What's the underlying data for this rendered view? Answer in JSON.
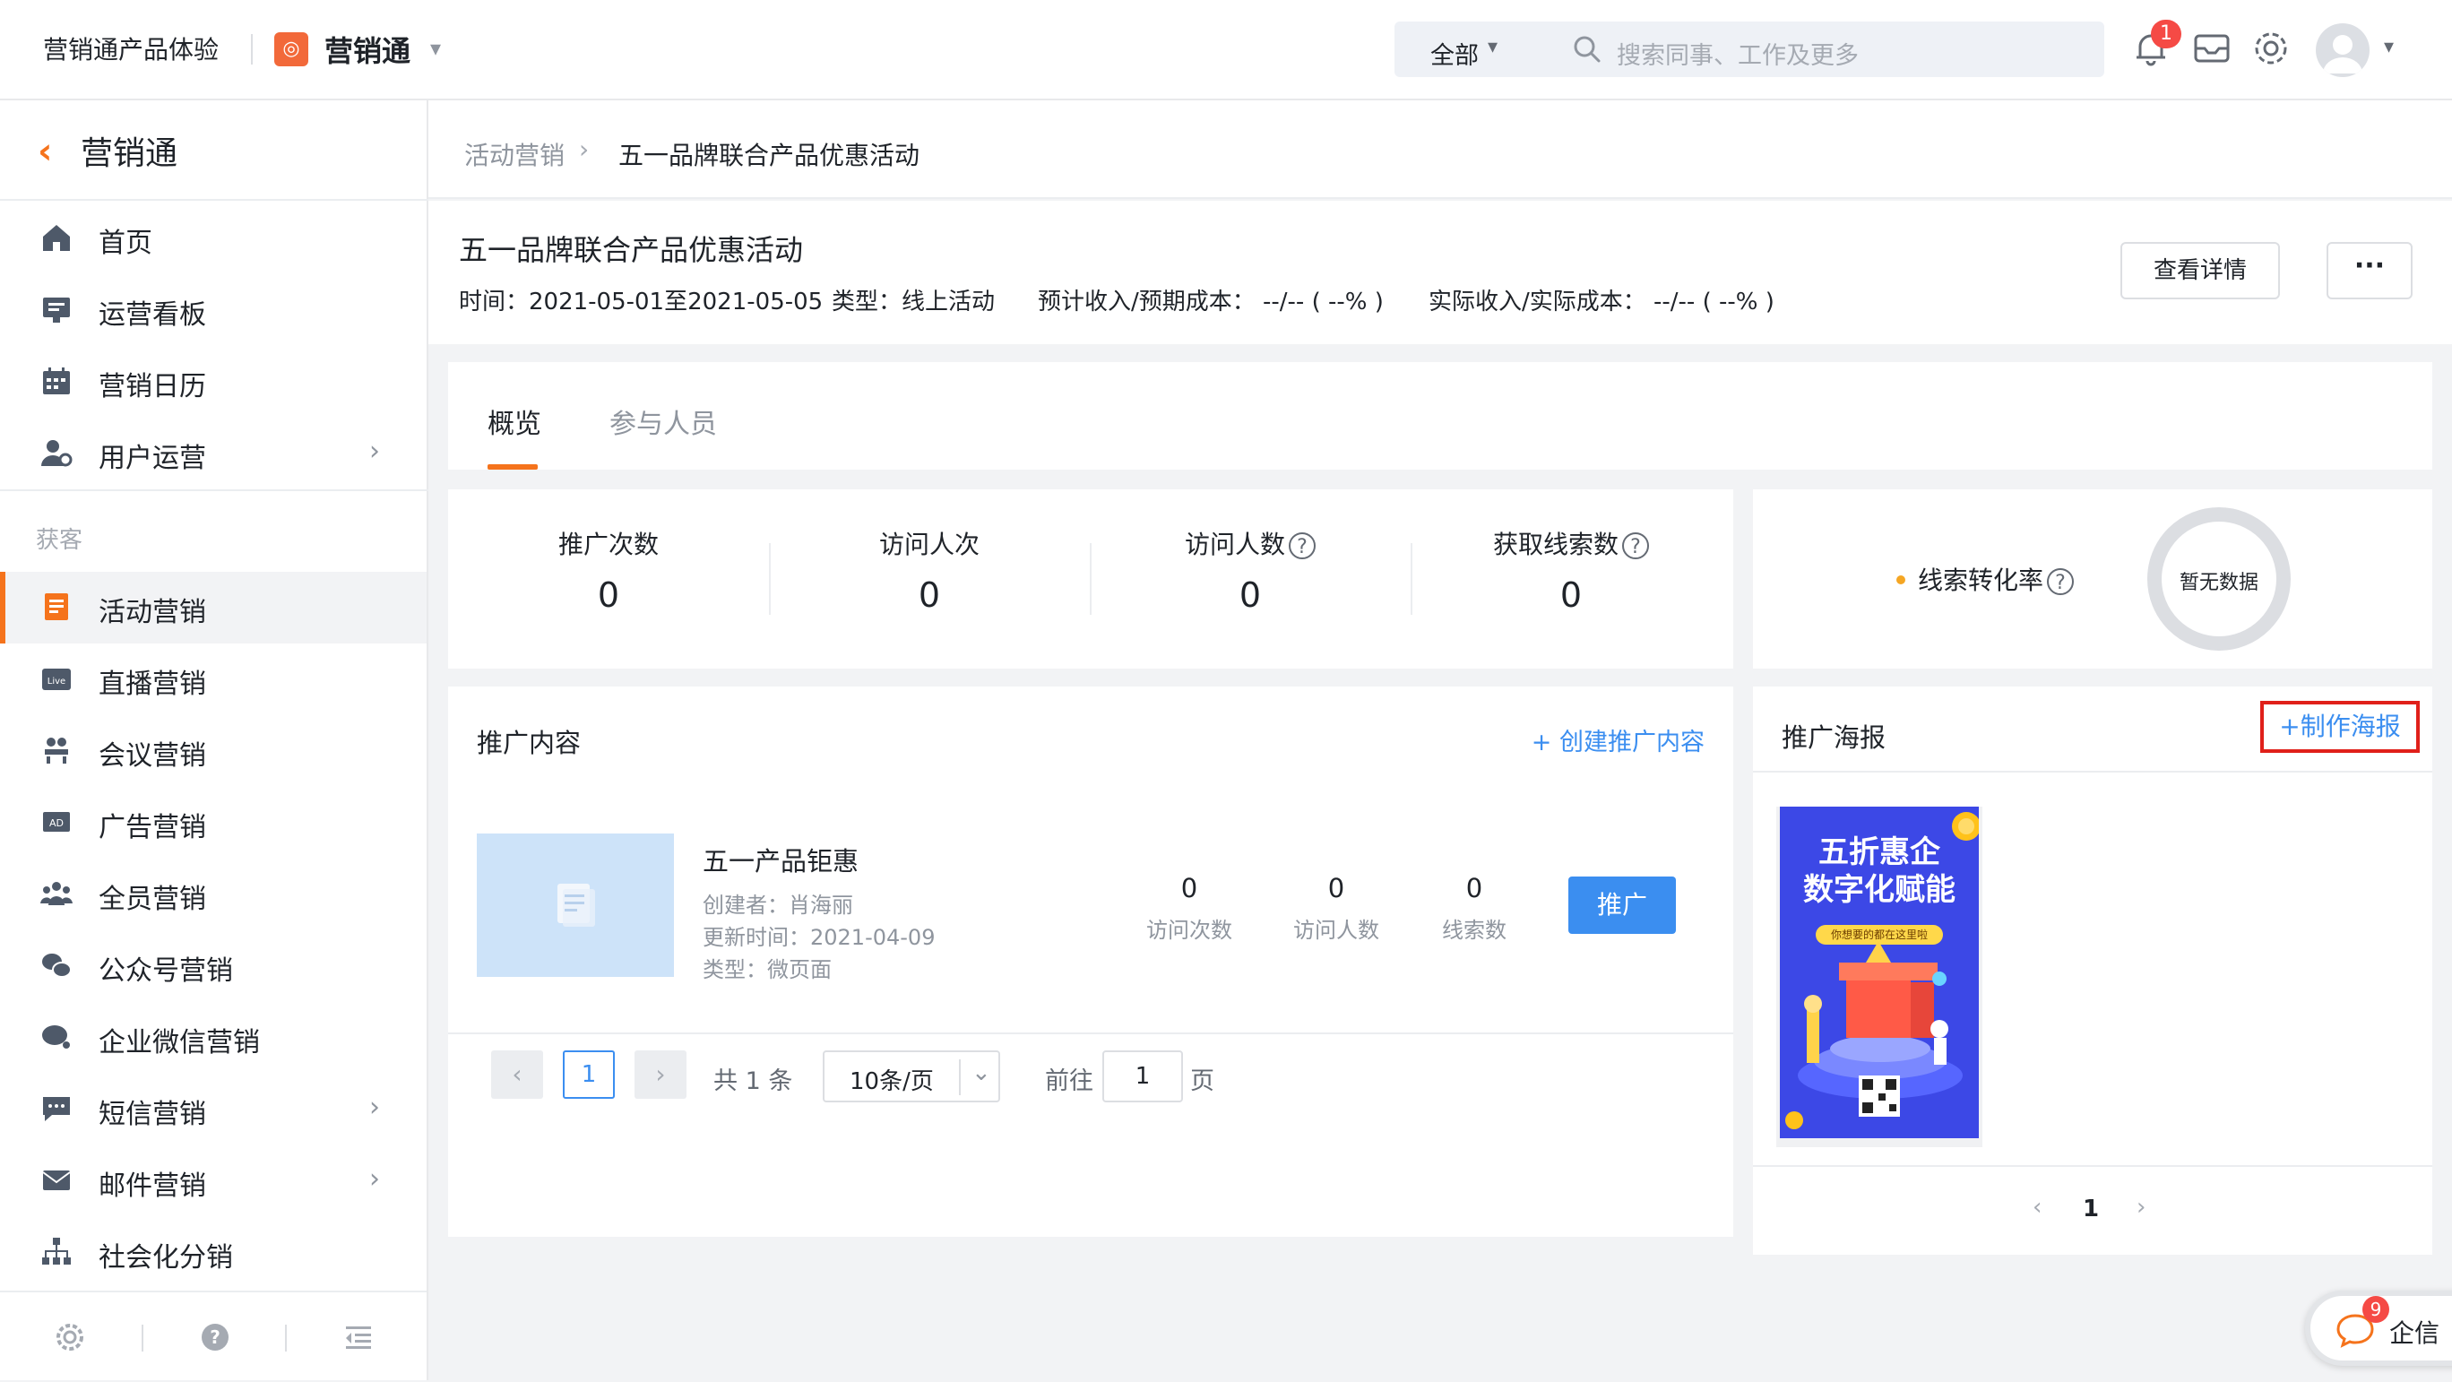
{
  "top": {
    "app_title": "营销通产品体验",
    "brand": "营销通",
    "search_scope": "全部",
    "search_placeholder": "搜索同事、工作及更多",
    "notif_count": "1"
  },
  "sidebar": {
    "title": "营销通",
    "items_top": [
      {
        "label": "首页",
        "icon": "home-icon"
      },
      {
        "label": "运营看板",
        "icon": "dashboard-icon"
      },
      {
        "label": "营销日历",
        "icon": "calendar-icon"
      },
      {
        "label": "用户运营",
        "icon": "user-ops-icon"
      }
    ],
    "group_label": "获客",
    "items_group": [
      {
        "label": "活动营销",
        "icon": "activity-icon"
      },
      {
        "label": "直播营销",
        "icon": "live-icon"
      },
      {
        "label": "会议营销",
        "icon": "meeting-icon"
      },
      {
        "label": "广告营销",
        "icon": "ad-icon"
      },
      {
        "label": "全员营销",
        "icon": "team-icon"
      },
      {
        "label": "公众号营销",
        "icon": "wechat-icon"
      },
      {
        "label": "企业微信营销",
        "icon": "wecom-icon"
      },
      {
        "label": "短信营销",
        "icon": "sms-icon"
      },
      {
        "label": "邮件营销",
        "icon": "mail-icon"
      },
      {
        "label": "社会化分销",
        "icon": "distribution-icon"
      }
    ]
  },
  "breadcrumb": {
    "parent": "活动营销",
    "current": "五一品牌联合产品优惠活动"
  },
  "header": {
    "title": "五一品牌联合产品优惠活动",
    "time": "时间：2021-05-01至2021-05-05",
    "type": "类型：线上活动",
    "expected": "预计收入/预期成本： --/-- ( --% )",
    "actual": "实际收入/实际成本： --/-- ( --% )",
    "detail_btn": "查看详情",
    "more_btn": "···"
  },
  "tabs": [
    {
      "label": "概览"
    },
    {
      "label": "参与人员"
    }
  ],
  "stats": [
    {
      "label": "推广次数",
      "value": "0"
    },
    {
      "label": "访问人次",
      "value": "0"
    },
    {
      "label": "访问人数",
      "value": "0"
    },
    {
      "label": "获取线索数",
      "value": "0"
    }
  ],
  "conversion": {
    "label": "线索转化率",
    "empty": "暂无数据"
  },
  "content": {
    "title": "推广内容",
    "create": "+ 创建推广内容",
    "item": {
      "title": "五一产品钜惠",
      "creator": "创建者：肖海丽",
      "updated": "更新时间：2021-04-09",
      "type": "类型：微页面",
      "stats": [
        {
          "value": "0",
          "label": "访问次数"
        },
        {
          "value": "0",
          "label": "访问人数"
        },
        {
          "value": "0",
          "label": "线索数"
        }
      ],
      "promote": "推广"
    },
    "pagination": {
      "current": "1",
      "total": "共 1 条",
      "page_size": "10条/页",
      "goto_label": "前往",
      "goto_value": "1",
      "page_suffix": "页"
    }
  },
  "poster": {
    "title": "推广海报",
    "make": "+制作海报",
    "image_headline": "五折惠企\n数字化赋能",
    "image_tagline": "你想要的都在这里啦",
    "page": "1"
  },
  "qixin": {
    "label": "企信",
    "badge": "9"
  },
  "colors": {
    "accent": "#f5731c",
    "link": "#3b8ef0",
    "danger": "#f54a45"
  }
}
